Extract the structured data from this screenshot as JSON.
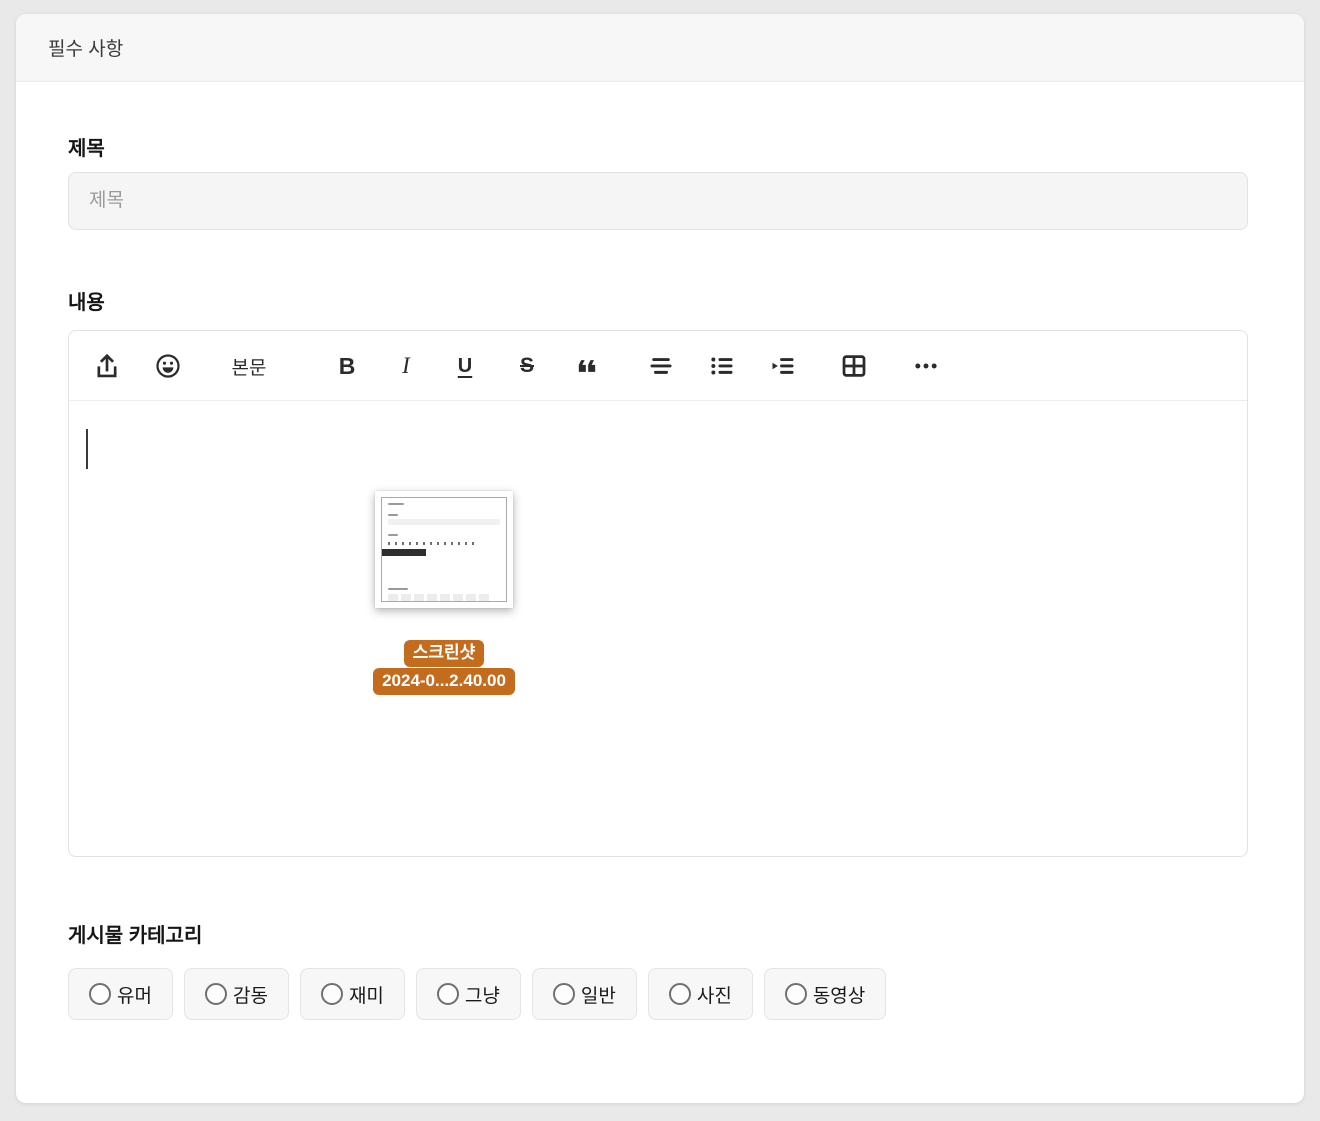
{
  "card": {
    "header_title": "필수 사항"
  },
  "title_section": {
    "label": "제목",
    "input_value": "",
    "input_placeholder": "제목"
  },
  "content_section": {
    "label": "내용",
    "toolbar": {
      "icons": [
        "upload-icon",
        "emoji-icon",
        "paragraph-style",
        "bold",
        "italic",
        "underline",
        "strikethrough",
        "blockquote-icon",
        "align-icon",
        "bullet-list-icon",
        "indent-icon",
        "table-icon",
        "more-icon"
      ],
      "paragraph_style": "본문",
      "bold": "B",
      "italic": "I",
      "underline": "U",
      "strikethrough": "S"
    },
    "attachment": {
      "label_top": "스크린샷",
      "label_bottom": "2024-0...2.40.00"
    }
  },
  "category_section": {
    "label": "게시물 카테고리",
    "options": [
      "유머",
      "감동",
      "재미",
      "그냥",
      "일반",
      "사진",
      "동영상"
    ]
  },
  "colors": {
    "accent_orange": "#c46c1e",
    "page_background": "#e9e9e9",
    "card_header_background": "#f7f7f7"
  }
}
